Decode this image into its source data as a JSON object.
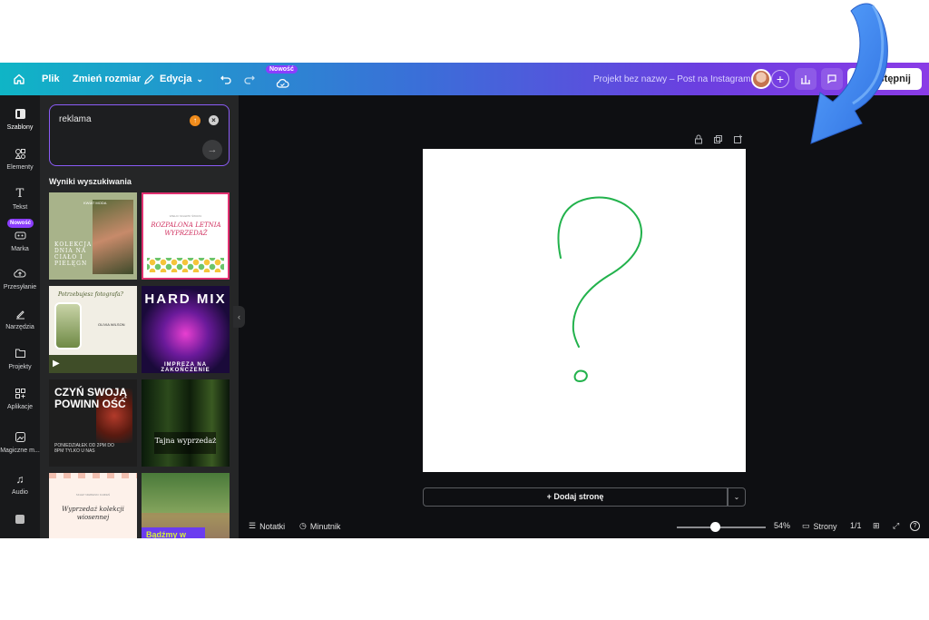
{
  "topbar": {
    "menu_file": "Plik",
    "menu_resize": "Zmień rozmiar",
    "menu_edit": "Edycja",
    "new_badge": "Nowość",
    "project_title": "Projekt bez nazwy – Post na Instagram",
    "share_label": "Udostępnij"
  },
  "rail": {
    "items": [
      {
        "label": "Szablony",
        "icon": "templates-icon"
      },
      {
        "label": "Elementy",
        "icon": "elements-icon"
      },
      {
        "label": "Tekst",
        "icon": "text-icon"
      },
      {
        "label": "Marka",
        "icon": "brand-icon",
        "badge": "Nowość"
      },
      {
        "label": "Przesyłanie",
        "icon": "upload-icon"
      },
      {
        "label": "Narzędzia",
        "icon": "tools-icon"
      },
      {
        "label": "Projekty",
        "icon": "folder-icon"
      },
      {
        "label": "Aplikacje",
        "icon": "apps-icon"
      },
      {
        "label": "Magiczne m...",
        "icon": "magic-media-icon"
      },
      {
        "label": "Audio",
        "icon": "audio-icon"
      }
    ]
  },
  "panel": {
    "search_value": "reklama",
    "results_title": "Wyniki wyszukiwania",
    "templates": [
      {
        "name": "template-floral-photo",
        "text": "KOLEKCJA DNIA NA CIAŁO I PIELĘGN",
        "tag": "KWIAT MODA"
      },
      {
        "name": "template-summer-sale",
        "text": "ROZPALONA LETNIA WYPRZEDAŻ",
        "tag": "WIELKI SKLEPIK ŚWIATA"
      },
      {
        "name": "template-photographer",
        "text": "Potrzebujesz fotografa?",
        "tag": "OLIVIA WILSON"
      },
      {
        "name": "template-hard-mix",
        "text": "HARD MIX",
        "tag": "IMPREZA NA ZAKOŃCZENIE"
      },
      {
        "name": "template-czyn-swoja-powinnosc",
        "text": "CZYŃ SWOJĄ POWINN OŚĆ",
        "tag": "PONIEDZIAŁEK OD 2PM DO 8PM TYLKO U NAS"
      },
      {
        "name": "template-tajna-wyprzedaz",
        "text": "Tajna wyprzedaż",
        "tag": ""
      },
      {
        "name": "template-wyprzedaz-kolekcji",
        "text": "Wyprzedaż kolekcji wiosennej",
        "tag": "SKLEP NIEBIESKI KAMIEŃ"
      },
      {
        "name": "template-badzmy-w-kontakcie",
        "text": "Bądźmy w kontakcie",
        "tag": ""
      }
    ]
  },
  "canvas": {
    "add_page": "+ Dodaj stronę"
  },
  "bottombar": {
    "notes": "Notatki",
    "timer": "Minutnik",
    "zoom": "54%",
    "pages_label": "Strony",
    "page_count": "1/1"
  },
  "colors": {
    "accent": "#8b3dff",
    "drawing_stroke": "#22b24c",
    "arrow": "#3d8bfd"
  }
}
